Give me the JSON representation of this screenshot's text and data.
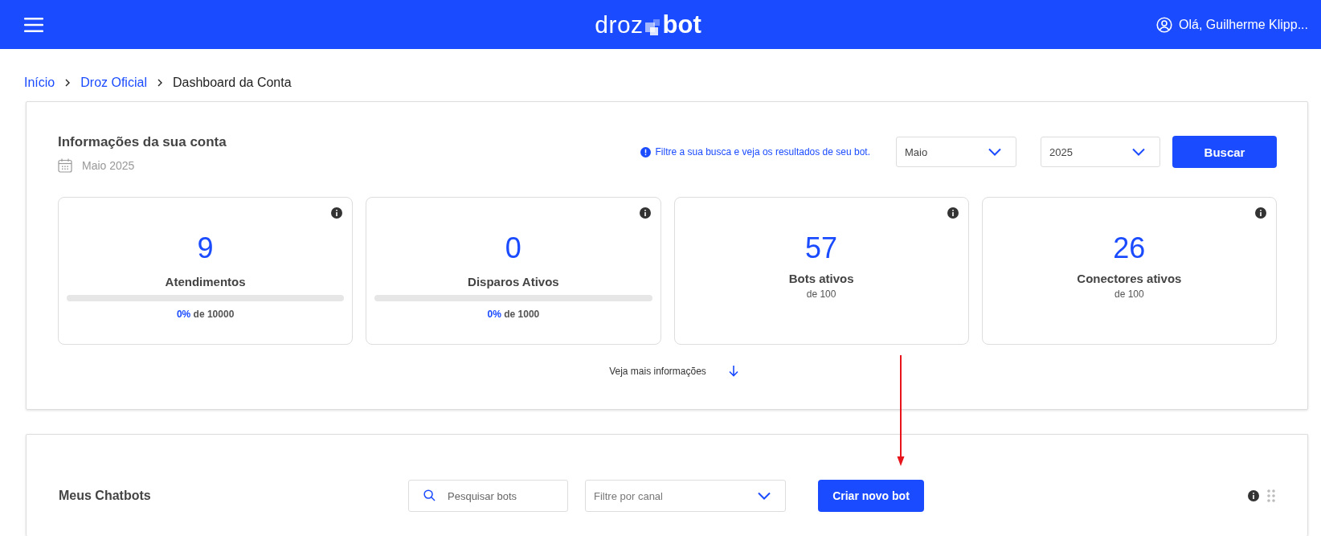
{
  "header": {
    "logo": {
      "left": "droz",
      "right": "bot"
    },
    "user": "Olá, Guilherme Klipp..."
  },
  "breadcrumb": [
    {
      "label": "Início",
      "link": true
    },
    {
      "label": "Droz Oficial",
      "link": true
    },
    {
      "label": "Dashboard da Conta",
      "link": false
    }
  ],
  "account": {
    "title": "Informações da sua conta",
    "period": "Maio 2025",
    "notice": "Filtre a sua busca e veja os resultados de seu bot.",
    "month": "Maio",
    "year": "2025",
    "button": "Buscar",
    "stats": [
      {
        "kind": "progress",
        "value": "9",
        "label": "Atendimentos",
        "level": 0,
        "percent": "0%",
        "total": "de 10000"
      },
      {
        "kind": "progress",
        "value": "0",
        "label": "Disparos Ativos",
        "level": 0,
        "percent": "0%",
        "total": "de 1000"
      },
      {
        "kind": "plain",
        "value": "57",
        "label": "Bots ativos",
        "total": "de 100"
      },
      {
        "kind": "plain",
        "value": "26",
        "label": "Conectores ativos",
        "total": "de 100"
      }
    ],
    "more": "Veja mais informações"
  },
  "chatbots": {
    "title": "Meus Chatbots",
    "search": {
      "placeholder": "Pesquisar bots"
    },
    "channel": {
      "placeholder": "Filtre por canal"
    },
    "button": "Criar novo bot"
  }
}
